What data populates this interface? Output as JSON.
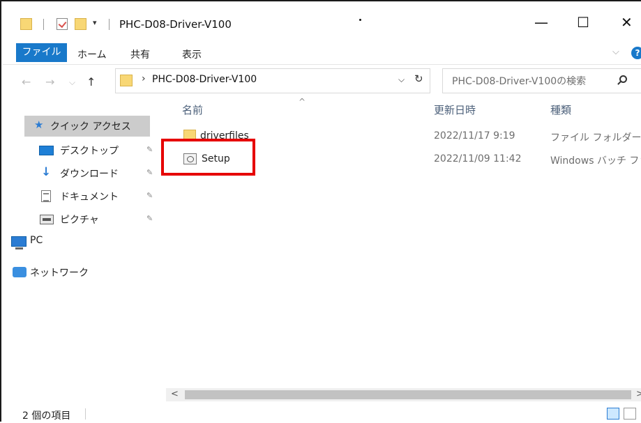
{
  "window": {
    "title": "PHC-D08-Driver-V100",
    "minimize": "—",
    "maximize": "☐",
    "close": "✕",
    "quick_access_dropdown": "▾"
  },
  "ribbon": {
    "tabs": [
      {
        "label": "ファイル",
        "active": true
      },
      {
        "label": "ホーム"
      },
      {
        "label": "共有"
      },
      {
        "label": "表示"
      }
    ],
    "collapse_chevron": "⌵",
    "help": "?"
  },
  "address": {
    "back": "←",
    "forward": "→",
    "recent": "⌵",
    "up": "↑",
    "chevron": "›",
    "path": "PHC-D08-Driver-V100",
    "dropdown": "⌵",
    "refresh": "↻"
  },
  "search": {
    "placeholder": "PHC-D08-Driver-V100の検索"
  },
  "nav_pane": {
    "items": [
      {
        "label": "クイック アクセス",
        "icon": "star-icon"
      },
      {
        "label": "デスクトップ",
        "icon": "desktop-icon",
        "pinned": true
      },
      {
        "label": "ダウンロード",
        "icon": "download-arrow-icon",
        "pinned": true
      },
      {
        "label": "ドキュメント",
        "icon": "document-icon",
        "pinned": true
      },
      {
        "label": "ピクチャ",
        "icon": "picture-icon",
        "pinned": true
      },
      {
        "label": "PC",
        "icon": "pc-monitor-icon"
      },
      {
        "label": "ネットワーク",
        "icon": "network-icon"
      }
    ],
    "pin_glyph": "📌"
  },
  "content": {
    "columns": [
      "名前",
      "更新日時",
      "種類"
    ],
    "sort_indicator": "^",
    "rows": [
      {
        "name": "driverfiles",
        "modified": "2022/11/17 9:19",
        "type": "ファイル フォルダー",
        "icon": "folder-icon"
      },
      {
        "name": "Setup",
        "modified": "2022/11/09 11:42",
        "type": "Windows バッチ ファ",
        "icon": "batch-file-icon",
        "highlighted": true
      }
    ]
  },
  "scrollbar": {
    "left": "<",
    "right": ">"
  },
  "status": {
    "item_count": "2 個の項目"
  },
  "colors": {
    "accent": "#1979ca",
    "highlight_box": "#e60000",
    "folder": "#f8d775"
  }
}
